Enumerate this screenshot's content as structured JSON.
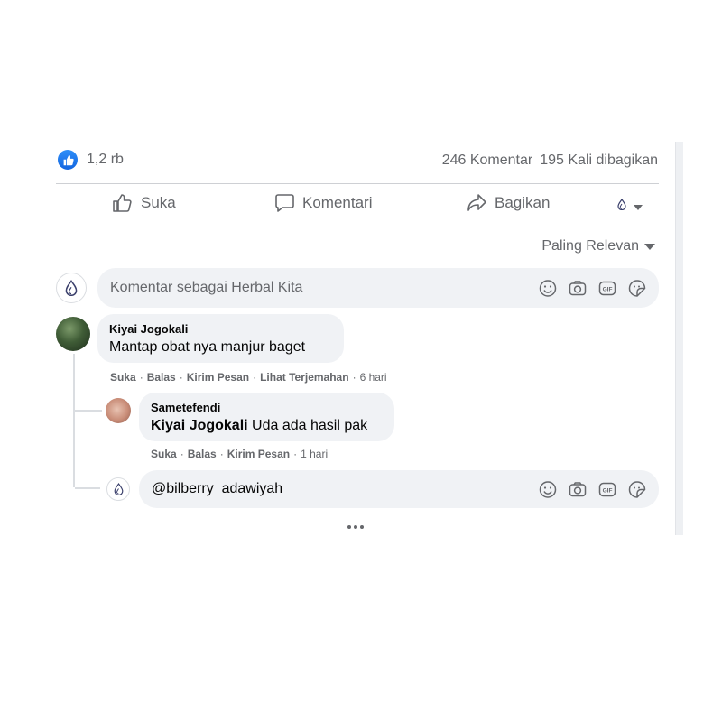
{
  "post_stats": {
    "reaction_count": "1,2 rb",
    "comments": "246 Komentar",
    "shares": "195 Kali dibagikan"
  },
  "actions": {
    "like": "Suka",
    "comment": "Komentari",
    "share": "Bagikan"
  },
  "sort": {
    "label": "Paling Relevan"
  },
  "composer": {
    "placeholder": "Komentar sebagai Herbal Kita"
  },
  "comments": [
    {
      "author": "Kiyai Jogokali",
      "text": "Mantap obat nya manjur baget",
      "actions": [
        "Suka",
        "Balas",
        "Kirim Pesan",
        "Lihat Terjemahan"
      ],
      "time": "6 hari",
      "replies": [
        {
          "author": "Sametefendi",
          "mention": "Kiyai Jogokali",
          "text": "Uda ada hasil pak",
          "actions": [
            "Suka",
            "Balas",
            "Kirim Pesan"
          ],
          "time": "1 hari"
        }
      ]
    }
  ],
  "reply_composer": {
    "value": "@bilberry_adawiyah"
  },
  "colors": {
    "facebook_blue": "#1877f2",
    "bubble_bg": "#f0f2f5",
    "secondary_text": "#65676b"
  },
  "icons": {
    "like_reaction": "thumbs-up-icon",
    "like_action": "thumbs-up-outline-icon",
    "comment_action": "speech-bubble-icon",
    "share_action": "share-arrow-icon",
    "sort": "caret-down-icon",
    "emoji": "smiley-icon",
    "camera": "camera-icon",
    "gif": "gif-icon",
    "sticker": "sticker-icon",
    "more": "more-dots-icon"
  }
}
